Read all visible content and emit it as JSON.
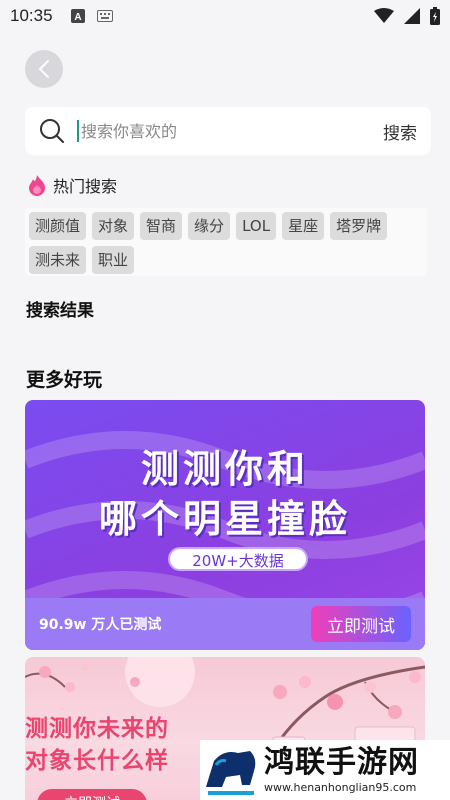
{
  "status": {
    "time": "10:35",
    "icons": [
      "a-badge-icon",
      "keyboard-icon",
      "wifi-icon",
      "signal-icon",
      "battery-icon"
    ]
  },
  "search": {
    "placeholder": "搜索你喜欢的",
    "value": "",
    "button_label": "搜索"
  },
  "hot": {
    "title": "热门搜索",
    "tags": [
      "测颜值",
      "对象",
      "智商",
      "缘分",
      "LOL",
      "星座",
      "塔罗牌",
      "测未来",
      "职业"
    ]
  },
  "results": {
    "title": "搜索结果"
  },
  "more": {
    "title": "更多好玩",
    "cards": [
      {
        "headline_line1": "测测你和",
        "headline_line2": "哪个明星撞脸",
        "pill": "20W+大数据",
        "count": "90.9w 万人已测试",
        "cta": "立即测试"
      },
      {
        "headline_line1": "测测你未来的",
        "headline_line2": "对象长什么样",
        "cta": "立即测试"
      }
    ]
  },
  "watermark": {
    "name": "鸿联手游网",
    "url": "www.henanhonglian95.com"
  },
  "colors": {
    "accent_teal": "#1d9a87",
    "card_purple": "#8c3fe0",
    "cta_pink": "#f03fb8",
    "card_pink_text": "#e8456f"
  }
}
